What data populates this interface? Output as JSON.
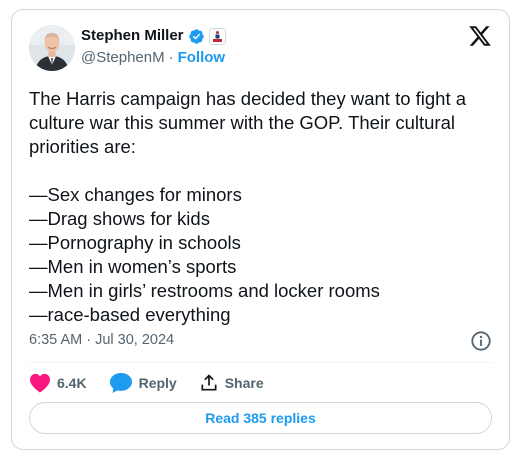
{
  "author": {
    "name": "Stephen Miller",
    "handle": "@StephenM",
    "separator": "·",
    "follow_label": "Follow",
    "verified_icon": "verified-badge-icon",
    "affiliation_icon": "affiliation-badge-icon"
  },
  "tweet": {
    "paragraph": "The Harris campaign has decided they want to fight a culture war this summer with the GOP. Their cultural priorities are:",
    "items": [
      "—Sex changes for minors",
      "—Drag shows for kids",
      "—Pornography in schools",
      "—Men in women’s sports",
      "—Men in girls’ restrooms and locker rooms",
      "—race-based everything"
    ],
    "timestamp": "6:35 AM · Jul 30, 2024"
  },
  "actions": {
    "like_count": "6.4K",
    "reply_label": "Reply",
    "share_label": "Share"
  },
  "read_replies_label": "Read 385 replies",
  "colors": {
    "accent": "#1d9bf0",
    "like": "#f91880",
    "text": "#0f1419",
    "muted": "#536471",
    "border": "#cfd9de"
  }
}
